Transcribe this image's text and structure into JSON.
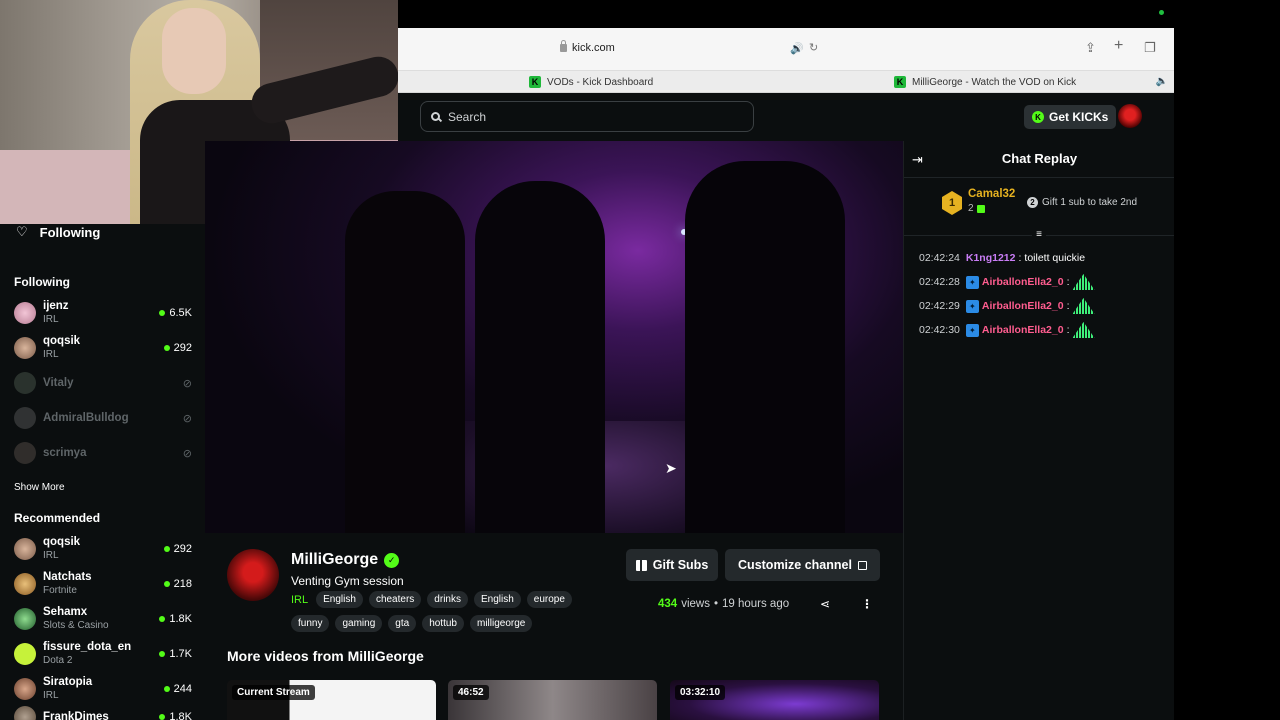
{
  "browser": {
    "url": "kick.com",
    "tabs": [
      {
        "label": "VODs - Kick Dashboard"
      },
      {
        "label": "MilliGeorge - Watch the VOD on Kick"
      }
    ]
  },
  "header": {
    "search_placeholder": "Search",
    "get_kicks_label": "Get KICKs"
  },
  "sidebar": {
    "nav_following": "Following",
    "following_title": "Following",
    "following": [
      {
        "name": "ijenz",
        "category": "IRL",
        "viewers": "6.5K",
        "live": true
      },
      {
        "name": "qoqsik",
        "category": "IRL",
        "viewers": "292",
        "live": true
      },
      {
        "name": "Vitaly",
        "live": false
      },
      {
        "name": "AdmiralBulldog",
        "live": false
      },
      {
        "name": "scrimya",
        "live": false
      }
    ],
    "show_more": "Show More",
    "recommended_title": "Recommended",
    "recommended": [
      {
        "name": "qoqsik",
        "category": "IRL",
        "viewers": "292"
      },
      {
        "name": "Natchats",
        "category": "Fortnite",
        "viewers": "218"
      },
      {
        "name": "Sehamx",
        "category": "Slots & Casino",
        "viewers": "1.8K"
      },
      {
        "name": "fissure_dota_en",
        "category": "Dota 2",
        "viewers": "1.7K"
      },
      {
        "name": "Siratopia",
        "category": "IRL",
        "viewers": "244"
      },
      {
        "name": "FrankDimes",
        "category": "",
        "viewers": "1.8K"
      }
    ]
  },
  "chat": {
    "title": "Chat Replay",
    "pinned": {
      "rank": "1",
      "name": "Camal32",
      "gift_count": "2",
      "cta_num": "2",
      "cta_text": "Gift 1 sub to take 2nd"
    },
    "messages": [
      {
        "time": "02:42:24",
        "user": "K1ng1212",
        "text": "toilett quickie",
        "color": "#c97df5",
        "badge": false,
        "emote": false
      },
      {
        "time": "02:42:28",
        "user": "AirballonElla2_0",
        "text": "",
        "color": "#ff5d8f",
        "badge": true,
        "emote": true
      },
      {
        "time": "02:42:29",
        "user": "AirballonElla2_0",
        "text": "",
        "color": "#ff5d8f",
        "badge": true,
        "emote": true
      },
      {
        "time": "02:42:30",
        "user": "AirballonElla2_0",
        "text": "",
        "color": "#ff5d8f",
        "badge": true,
        "emote": true
      }
    ]
  },
  "channel": {
    "name": "MilliGeorge",
    "stream_title": "Venting Gym session",
    "category": "IRL",
    "tags_row1": [
      "English",
      "cheaters",
      "drinks",
      "English",
      "europe"
    ],
    "tags_row2": [
      "funny",
      "gaming",
      "gta",
      "hottub",
      "milligeorge"
    ],
    "gift_subs_label": "Gift Subs",
    "customize_label": "Customize channel",
    "views_count": "434",
    "views_word": "views",
    "separator": "•",
    "time_ago": "19 hours ago",
    "more_videos_title": "More videos from MilliGeorge",
    "thumbnails": [
      {
        "label": "Current Stream"
      },
      {
        "label": "46:52"
      },
      {
        "label": "03:32:10"
      }
    ]
  },
  "colors": {
    "kick_green": "#53fc18",
    "background": "#0b0e0f",
    "rank_gold": "#e6b221"
  }
}
